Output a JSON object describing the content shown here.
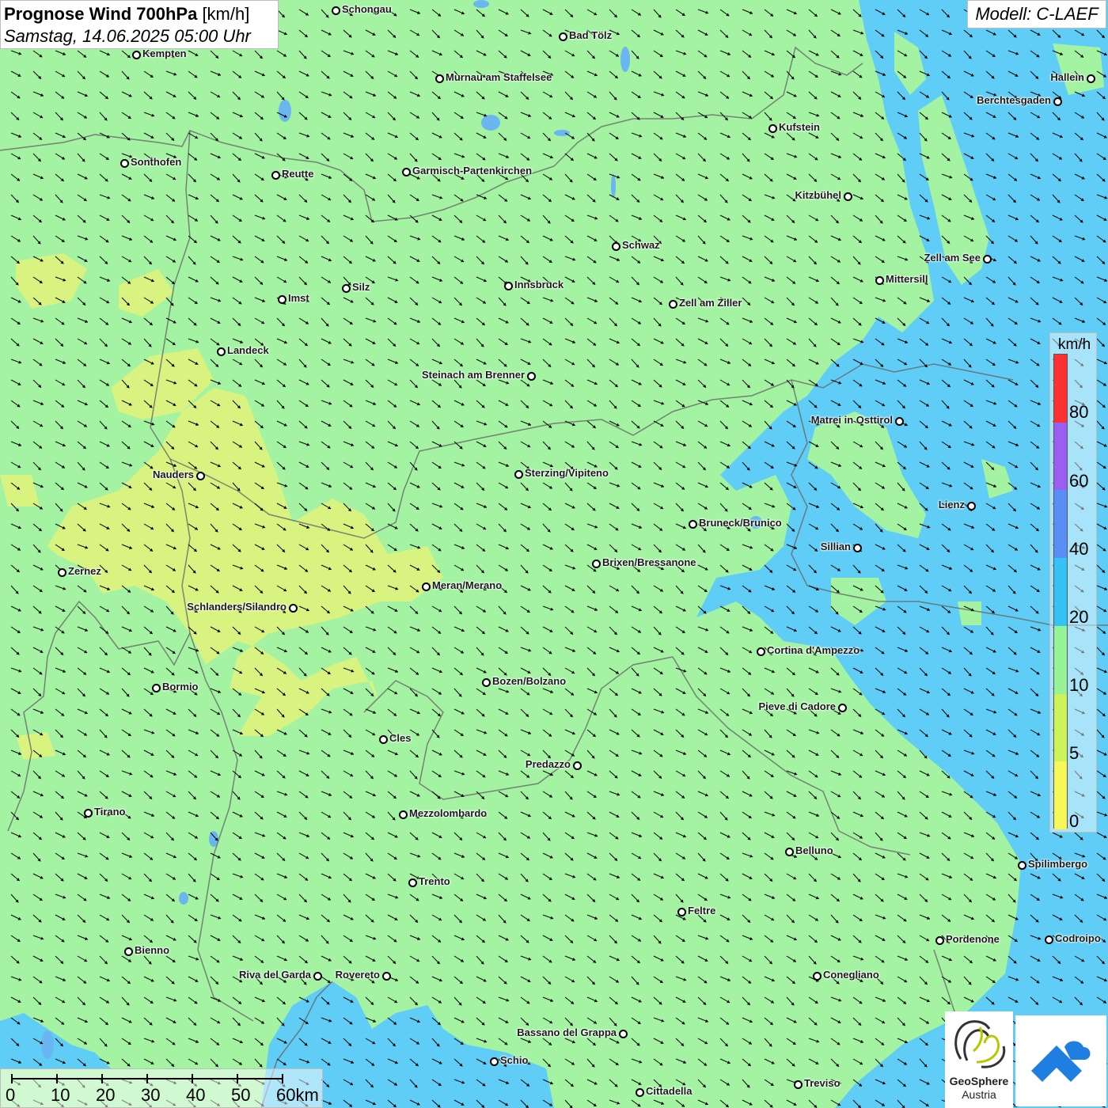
{
  "header": {
    "title": "Prognose Wind 700hPa",
    "unit": "[km/h]",
    "datetime": "Samstag, 14.06.2025 05:00 Uhr",
    "model": "Modell: C-LAEF"
  },
  "legend": {
    "unit": "km/h",
    "ticks": [
      "80",
      "60",
      "40",
      "20",
      "10",
      "5",
      "0"
    ],
    "colors": [
      "#ff3030",
      "#9a5ef0",
      "#5b8ef5",
      "#35c3f5",
      "#98f398",
      "#ccf359",
      "#f7f75a"
    ]
  },
  "scale": {
    "labels": [
      "0",
      "10",
      "20",
      "30",
      "40",
      "50",
      "60km"
    ]
  },
  "map_colors": {
    "green": "#a3f3a3",
    "blue": "#5fcdf5",
    "yellow": "#d9f380",
    "lake": "#6ab6f0"
  },
  "wind": {
    "direction": "northwest",
    "arrow_color": "#000000"
  },
  "logos": {
    "geosphere_name": "GeoSphere",
    "geosphere_sub": "Austria"
  },
  "cities": [
    {
      "name": "Schongau",
      "side": "r"
    },
    {
      "name": "Bad Tölz",
      "side": "r"
    },
    {
      "name": "Kempten",
      "side": "r"
    },
    {
      "name": "Murnau am Staffelsee",
      "side": "r"
    },
    {
      "name": "Hallein",
      "side": "l"
    },
    {
      "name": "Berchtesgaden",
      "side": "l"
    },
    {
      "name": "Kufstein",
      "side": "r"
    },
    {
      "name": "Sonthofen",
      "side": "r"
    },
    {
      "name": "Reutte",
      "side": "r"
    },
    {
      "name": "Garmisch-Partenkirchen",
      "side": "r"
    },
    {
      "name": "Kitzbühel",
      "side": "l"
    },
    {
      "name": "Schwaz",
      "side": "r"
    },
    {
      "name": "Zell am See",
      "side": "l"
    },
    {
      "name": "Mittersill",
      "side": "r"
    },
    {
      "name": "Silz",
      "side": "r"
    },
    {
      "name": "Innsbruck",
      "side": "r"
    },
    {
      "name": "Imst",
      "side": "r"
    },
    {
      "name": "Zell am Ziller",
      "side": "r"
    },
    {
      "name": "Landeck",
      "side": "r"
    },
    {
      "name": "Steinach am Brenner",
      "side": "l"
    },
    {
      "name": "Matrei in Osttirol",
      "side": "l"
    },
    {
      "name": "Nauders",
      "side": "l"
    },
    {
      "name": "Sterzing/Vipiteno",
      "side": "r"
    },
    {
      "name": "Lienz",
      "side": "l"
    },
    {
      "name": "Bruneck/Brunico",
      "side": "r"
    },
    {
      "name": "Sillian",
      "side": "l"
    },
    {
      "name": "Zernez",
      "side": "r"
    },
    {
      "name": "Brixen/Bressanone",
      "side": "r"
    },
    {
      "name": "Meran/Merano",
      "side": "r"
    },
    {
      "name": "Schlanders/Silandro",
      "side": "l"
    },
    {
      "name": "Cortina d'Ampezzo",
      "side": "r"
    },
    {
      "name": "Bozen/Bolzano",
      "side": "r"
    },
    {
      "name": "Bormio",
      "side": "r"
    },
    {
      "name": "Pieve di Cadore",
      "side": "l"
    },
    {
      "name": "Cles",
      "side": "r"
    },
    {
      "name": "Predazzo",
      "side": "l"
    },
    {
      "name": "Tirano",
      "side": "r"
    },
    {
      "name": "Mezzolombardo",
      "side": "r"
    },
    {
      "name": "Belluno",
      "side": "r"
    },
    {
      "name": "Spilimbergo",
      "side": "r"
    },
    {
      "name": "Trento",
      "side": "r"
    },
    {
      "name": "Feltre",
      "side": "r"
    },
    {
      "name": "Bienno",
      "side": "r"
    },
    {
      "name": "Pordenone",
      "side": "r"
    },
    {
      "name": "Codroipo",
      "side": "r"
    },
    {
      "name": "Riva del Garda",
      "side": "l"
    },
    {
      "name": "Rovereto",
      "side": "l"
    },
    {
      "name": "Conegliano",
      "side": "r"
    },
    {
      "name": "Bassano del Grappa",
      "side": "l"
    },
    {
      "name": "Schio",
      "side": "r"
    },
    {
      "name": "Treviso",
      "side": "r"
    },
    {
      "name": "Cittadella",
      "side": "r"
    }
  ]
}
